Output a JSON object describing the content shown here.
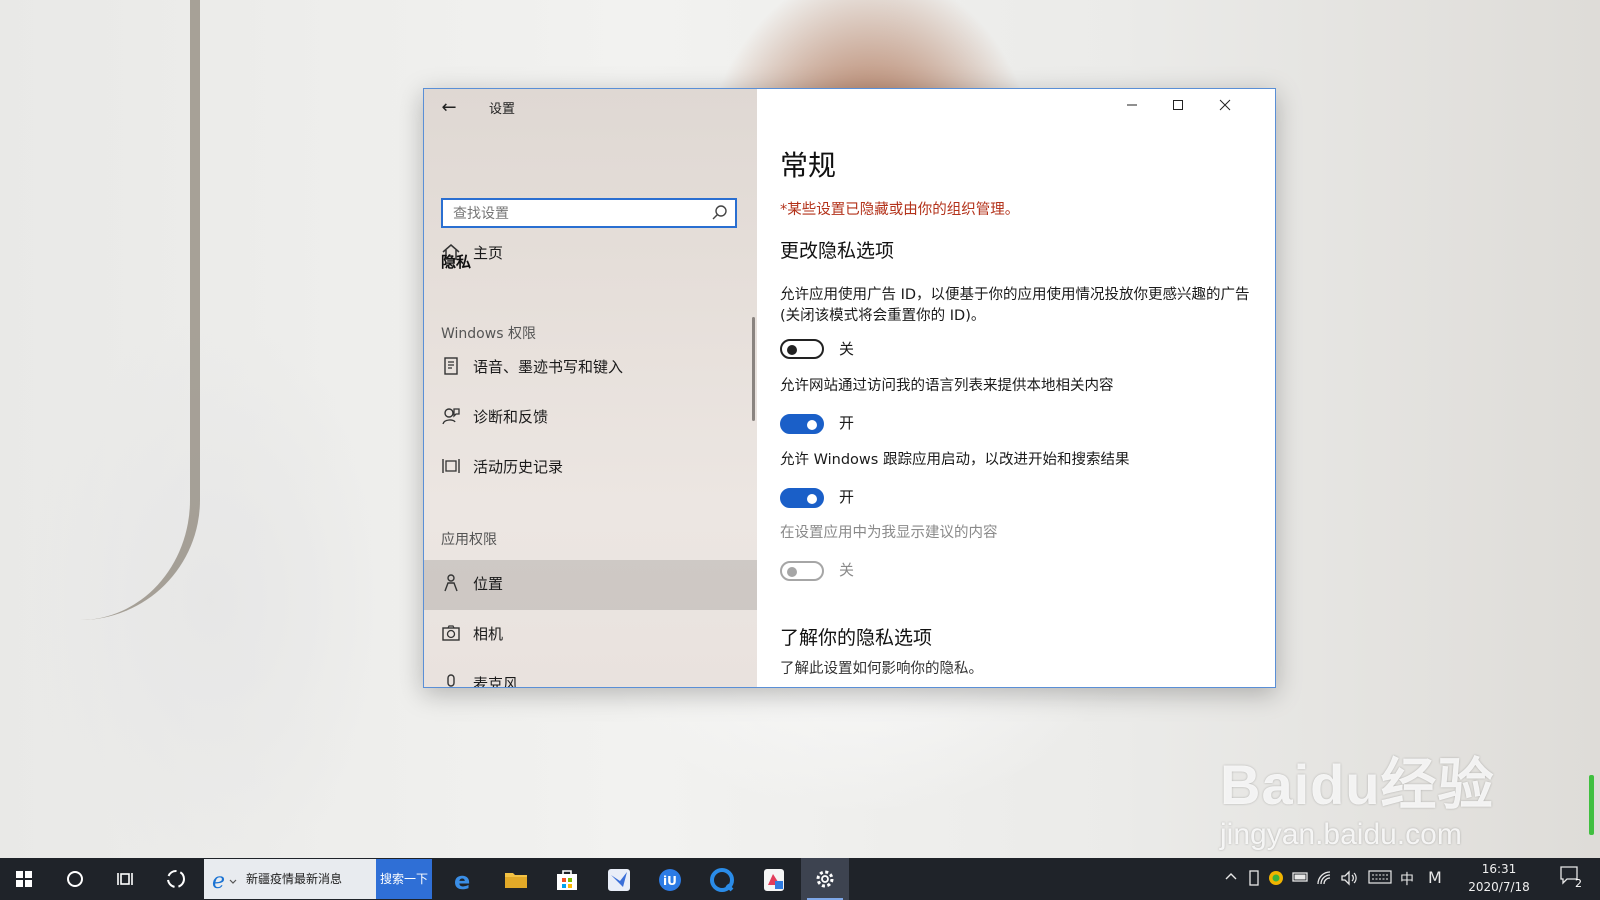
{
  "window": {
    "title": "设置",
    "back_glyph": "←"
  },
  "sidebar": {
    "home_label": "主页",
    "search_placeholder": "查找设置",
    "section": "隐私",
    "groups": {
      "windows_permissions": "Windows 权限",
      "app_permissions": "应用权限"
    },
    "items": [
      {
        "label": "语音、墨迹书写和键入",
        "icon": "speech-ink-icon"
      },
      {
        "label": "诊断和反馈",
        "icon": "feedback-icon"
      },
      {
        "label": "活动历史记录",
        "icon": "activity-history-icon"
      },
      {
        "label": "位置",
        "icon": "location-icon",
        "selected": true
      },
      {
        "label": "相机",
        "icon": "camera-icon"
      },
      {
        "label": "麦克风",
        "icon": "microphone-icon"
      }
    ]
  },
  "main": {
    "title": "常规",
    "managed_notice": "*某些设置已隐藏或由你的组织管理。",
    "section_change": "更改隐私选项",
    "options": [
      {
        "text": "允许应用使用广告 ID，以便基于你的应用使用情况投放你更感兴趣的广告(关闭该模式将会重置你的 ID)。",
        "state": "关",
        "on": false
      },
      {
        "text": "允许网站通过访问我的语言列表来提供本地相关内容",
        "state": "开",
        "on": true
      },
      {
        "text": "允许 Windows 跟踪应用启动，以改进开始和搜索结果",
        "state": "开",
        "on": true
      },
      {
        "text": "在设置应用中为我显示建议的内容",
        "state": "关",
        "on": false,
        "disabled": true
      }
    ],
    "section_learn": "了解你的隐私选项",
    "learn_text": "了解此设置如何影响你的隐私。"
  },
  "taskbar": {
    "news_text": "新疆疫情最新消息",
    "search_button": "搜索一下",
    "tray_ime": "中",
    "tray_m": "M",
    "time": "16:31",
    "date": "2020/7/18",
    "notification_count": "2"
  },
  "watermark": {
    "main": "Baidu经验",
    "sub": "jingyan.baidu.com"
  },
  "colors": {
    "accent": "#1a5fc8",
    "notice": "#b3321a",
    "taskbar": "#1f2329"
  }
}
